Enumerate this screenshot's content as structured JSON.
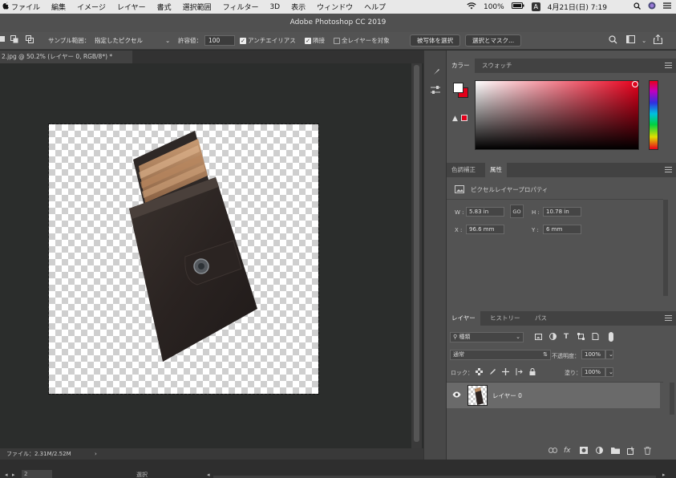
{
  "menubar": {
    "items": [
      "ファイル",
      "編集",
      "イメージ",
      "レイヤー",
      "書式",
      "選択範囲",
      "フィルター",
      "3D",
      "表示",
      "ウィンドウ",
      "ヘルプ"
    ],
    "battery": "100%",
    "input_badge": "A",
    "datetime": "4月21日(日) 7:19"
  },
  "title": "Adobe Photoshop CC 2019",
  "options": {
    "sample_label": "サンプル範囲：",
    "sample_value": "指定したピクセル",
    "tolerance_label": "許容値：",
    "tolerance_value": "100",
    "antialias_label": "アンチエイリアス",
    "contiguous_label": "隣接",
    "all_layers_label": "全レイヤーを対象",
    "select_subject_label": "被写体を選択",
    "select_mask_label": "選択とマスク..."
  },
  "document": {
    "tab_label": "2.jpg @ 50.2% (レイヤー 0, RGB/8*) *",
    "status_text": "ファイル：2.31M/2.52M",
    "bottom_page": "2",
    "bottom_label": "選択"
  },
  "color_panel": {
    "tabs": [
      "カラー",
      "スウォッチ"
    ],
    "foreground": "#ffffff",
    "background": "#e2001a",
    "hue_color": "#e8001c"
  },
  "properties_panel": {
    "tabs": [
      "色調補正",
      "属性"
    ],
    "section_title": "ピクセルレイヤープロパティ",
    "w_label": "W :",
    "w_value": "5.83 in",
    "link_label": "GO",
    "h_label": "H :",
    "h_value": "10.78 in",
    "x_label": "X :",
    "x_value": "96.6 mm",
    "y_label": "Y :",
    "y_value": "6 mm"
  },
  "layers_panel": {
    "tabs": [
      "レイヤー",
      "ヒストリー",
      "パス"
    ],
    "filter_label": "種類",
    "blend_mode": "通常",
    "opacity_label": "不透明度：",
    "opacity_value": "100%",
    "lock_label": "ロック：",
    "fill_label": "塗り：",
    "fill_value": "100%",
    "layer_name": "レイヤー 0"
  }
}
